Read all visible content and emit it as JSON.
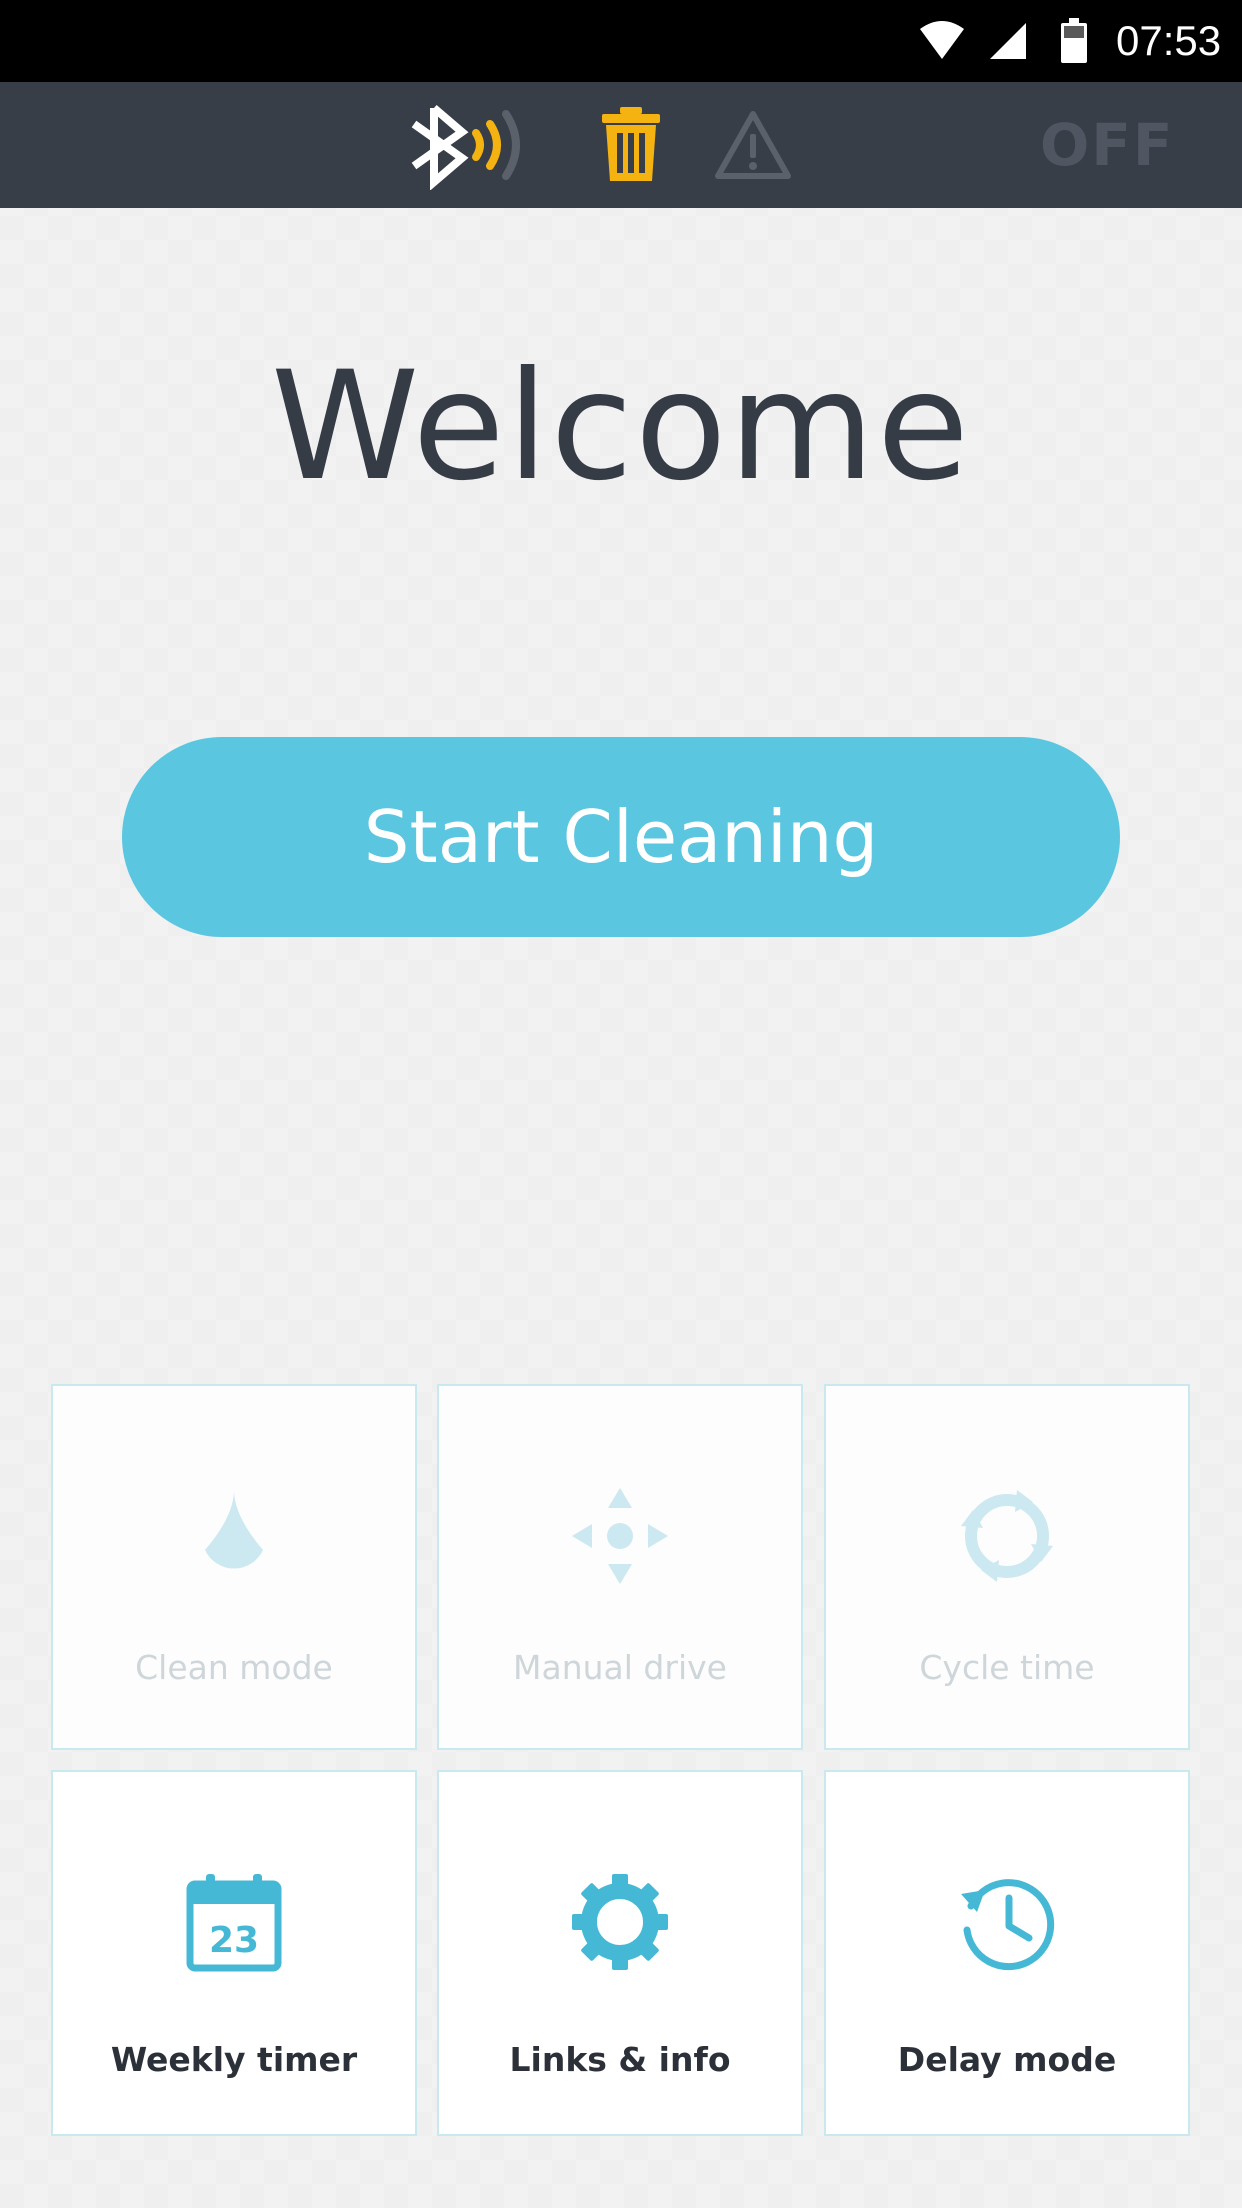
{
  "status_bar": {
    "time": "07:53",
    "icons": [
      "wifi-icon",
      "signal-icon",
      "battery-icon"
    ]
  },
  "toolbar": {
    "icons": [
      "bluetooth-signal-icon",
      "trash-icon",
      "warning-icon"
    ],
    "power_label": "OFF",
    "colors": {
      "bar": "#383e48",
      "trash": "#f5b312",
      "bluetooth": "#ffffff",
      "warning": "#5a616b"
    }
  },
  "main": {
    "welcome": "Welcome",
    "start_button": "Start Cleaning",
    "accent_color": "#5bc6e0"
  },
  "tiles": [
    {
      "label": "Clean mode",
      "icon": "water-drop-icon",
      "enabled": false
    },
    {
      "label": "Manual drive",
      "icon": "direction-pad-icon",
      "enabled": false
    },
    {
      "label": "Cycle time",
      "icon": "cycle-arrows-icon",
      "enabled": false
    },
    {
      "label": "Weekly timer",
      "icon": "calendar-icon",
      "calendar_day": "23",
      "enabled": true
    },
    {
      "label": "Links & info",
      "icon": "gear-icon",
      "enabled": true
    },
    {
      "label": "Delay mode",
      "icon": "clock-history-icon",
      "enabled": true
    }
  ]
}
